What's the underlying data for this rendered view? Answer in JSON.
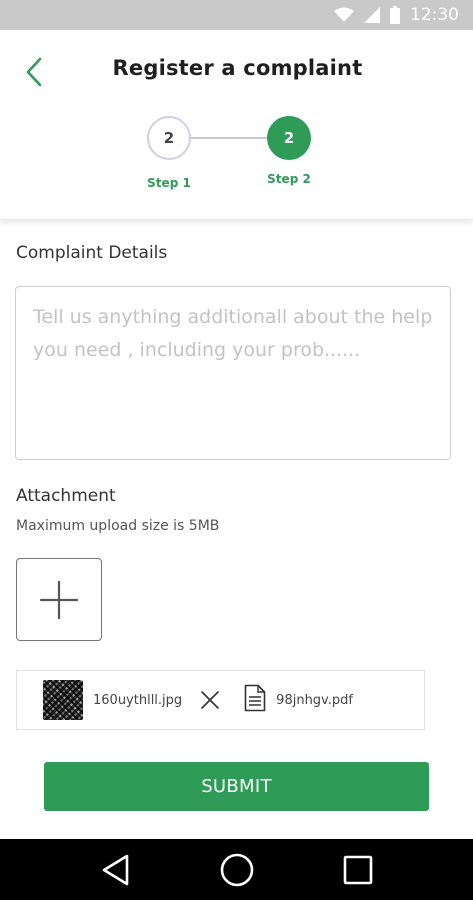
{
  "status_bar": {
    "time": "12:30"
  },
  "header": {
    "title": "Register a complaint"
  },
  "stepper": {
    "steps": [
      {
        "number": "2",
        "label": "Step 1"
      },
      {
        "number": "2",
        "label": "Step 2"
      }
    ],
    "active_step": 2
  },
  "details": {
    "title": "Complaint Details",
    "placeholder": "Tell us anything additionall about the help you need , including your prob......"
  },
  "attachment": {
    "title": "Attachment",
    "hint": "Maximum upload size is 5MB",
    "files": [
      {
        "name": "160uythlll.jpg",
        "type": "image"
      },
      {
        "name": "98jnhgv.pdf",
        "type": "pdf"
      }
    ]
  },
  "actions": {
    "submit_label": "SUBMIT"
  },
  "colors": {
    "accent": "#2e9b57",
    "status_bar": "#c9c9c9",
    "nav_bar": "#000000"
  },
  "icons": [
    "wifi-icon",
    "signal-icon",
    "battery-icon",
    "back-chevron-icon",
    "plus-icon",
    "close-icon",
    "document-icon",
    "nav-back-icon",
    "nav-home-icon",
    "nav-recents-icon"
  ]
}
